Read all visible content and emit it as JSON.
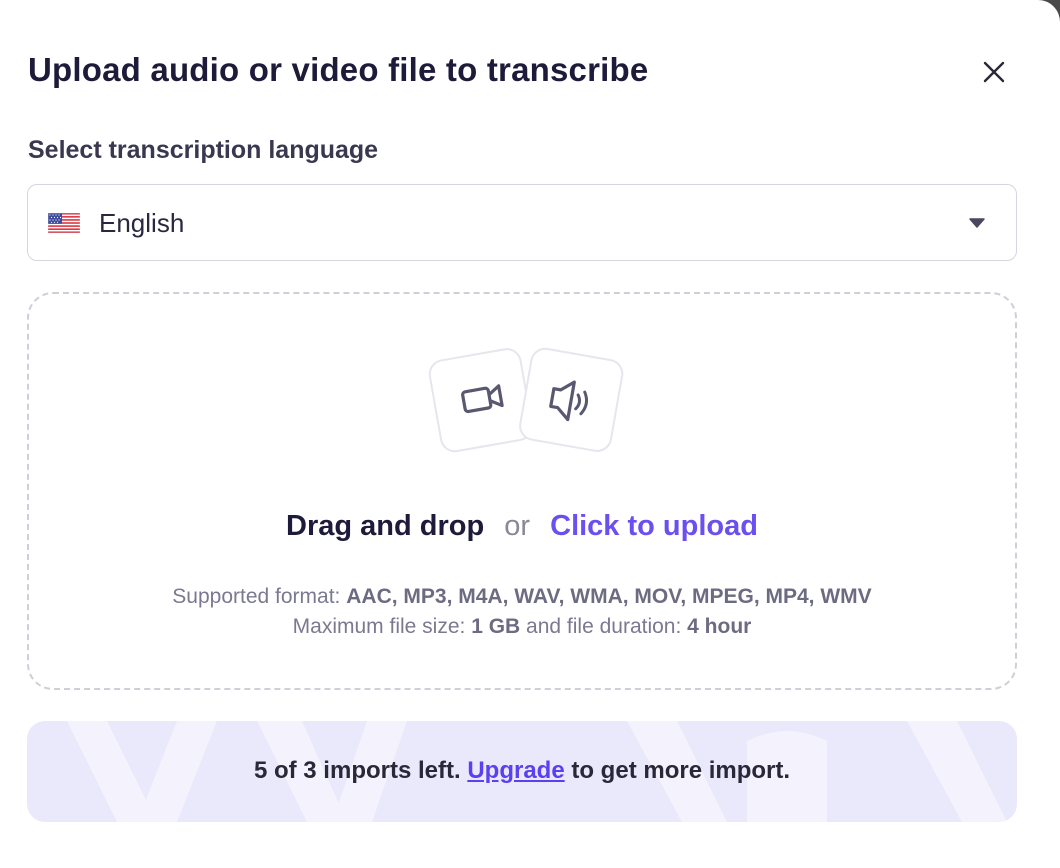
{
  "dialog": {
    "title": "Upload audio or video file to transcribe",
    "close_icon": "close-icon"
  },
  "language": {
    "label": "Select transcription language",
    "selected": "English",
    "flag_icon": "us-flag-icon",
    "caret_icon": "caret-down-icon"
  },
  "dropzone": {
    "icons": [
      "video-camera-icon",
      "speaker-icon"
    ],
    "drag_text": "Drag and drop",
    "or_text": "or",
    "upload_text": "Click to upload",
    "format_label": "Supported format:",
    "formats": "AAC, MP3, M4A, WAV, WMA, MOV, MPEG, MP4, WMV",
    "size_label": "Maximum file size:",
    "size_value": "1 GB",
    "duration_label": "and file duration:",
    "duration_value": "4 hour"
  },
  "banner": {
    "count_text": "5 of 3 imports left.",
    "upgrade_text": "Upgrade",
    "suffix_text": "to get more import."
  },
  "colors": {
    "accent": "#6b4ff0",
    "title": "#1e1b3a",
    "banner_bg": "#eae8fb"
  }
}
